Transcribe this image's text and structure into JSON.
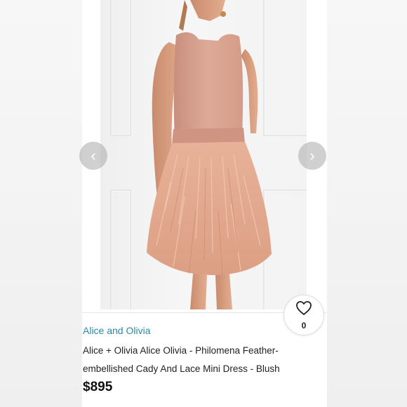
{
  "listing": {
    "brand": "Alice and Olivia",
    "title": "Alice + Olivia Alice Olivia - Philomena Feather-embellished Cady And Lace Mini Dress - Blush",
    "price": "$895",
    "likes": "0"
  },
  "carousel": {
    "prev_icon": "chevron-left-icon",
    "next_icon": "chevron-right-icon",
    "prev_glyph": "‹",
    "next_glyph": "›"
  },
  "colors": {
    "brand_link": "#2a8aa6",
    "dress_top": "#d9a492",
    "feathers": "#e2a689"
  }
}
